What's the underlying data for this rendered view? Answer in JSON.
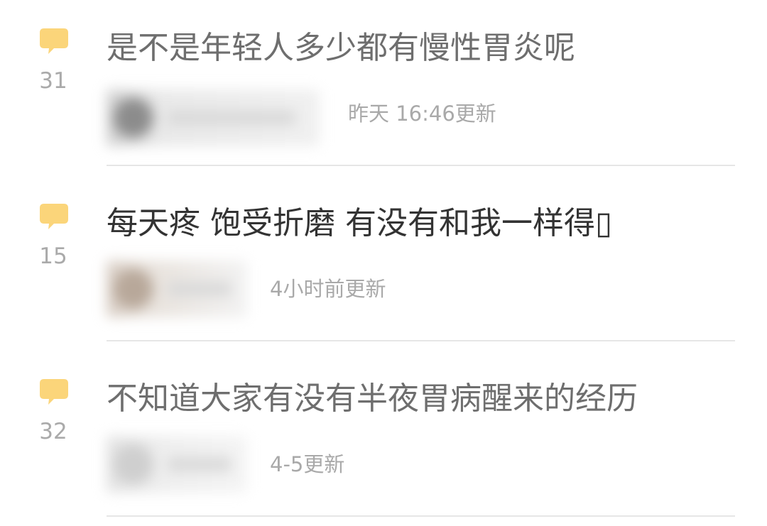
{
  "accent_color": "#fbd57a",
  "threads": [
    {
      "title": "是不是年轻人多少都有慢性胃炎呢",
      "reply_count": "31",
      "updated": "昨天 16:46更新",
      "icon": "comment-bubble-icon"
    },
    {
      "title": "每天疼 饱受折磨 有没有和我一样得▯",
      "reply_count": "15",
      "updated": "4小时前更新",
      "icon": "comment-bubble-icon"
    },
    {
      "title": "不知道大家有没有半夜胃病醒来的经历",
      "reply_count": "32",
      "updated": "4-5更新",
      "icon": "comment-bubble-icon"
    }
  ]
}
